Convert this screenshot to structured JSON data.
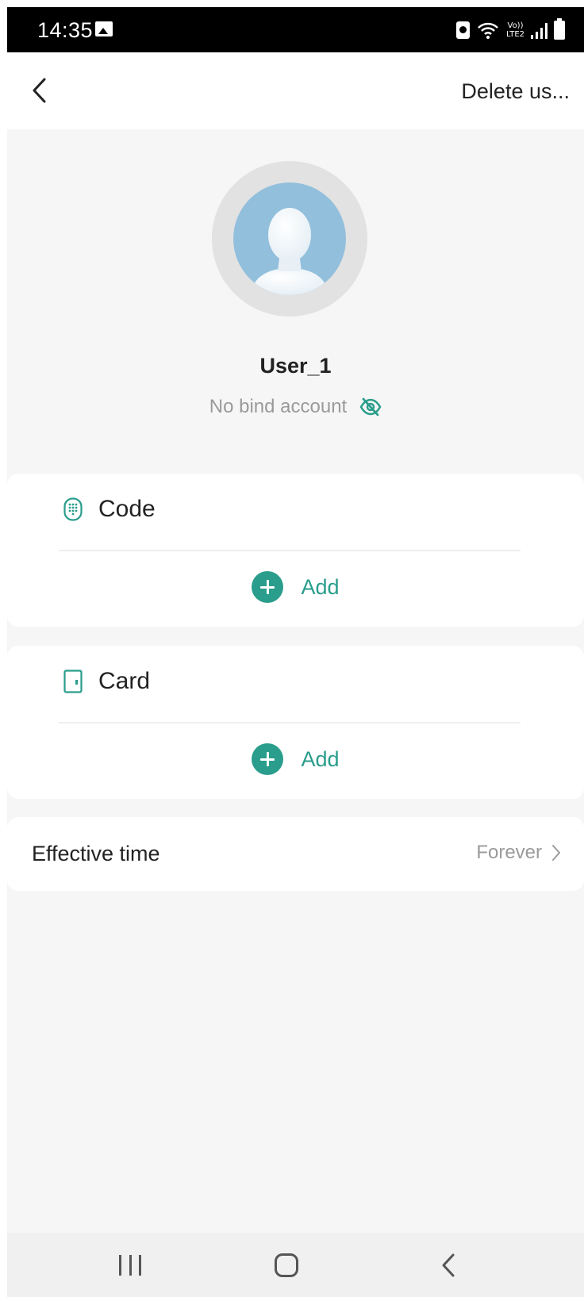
{
  "status_bar": {
    "time": "14:35",
    "lte_top": "Vo))",
    "lte_bottom": "LTE2",
    "icons": [
      "gallery-icon",
      "alarm-icon",
      "wifi-icon",
      "signal-icon",
      "battery-icon"
    ]
  },
  "header": {
    "back_icon": "chevron-left-icon",
    "delete_label": "Delete us..."
  },
  "profile": {
    "username": "User_1",
    "bind_status": "No bind account",
    "bind_icon": "eye-off-icon"
  },
  "sections": {
    "code": {
      "title": "Code",
      "icon": "keypad-icon",
      "add_label": "Add"
    },
    "card": {
      "title": "Card",
      "icon": "card-icon",
      "add_label": "Add"
    }
  },
  "effective_time": {
    "label": "Effective time",
    "value": "Forever",
    "chevron": "chevron-right-icon"
  },
  "colors": {
    "accent": "#2a9d8c",
    "background": "#f6f6f6",
    "avatar_bg": "#92bfdc",
    "secondary_text": "#9a9a9a"
  },
  "nav_bar": {
    "icons": [
      "recent-apps-icon",
      "home-icon",
      "back-icon"
    ]
  }
}
